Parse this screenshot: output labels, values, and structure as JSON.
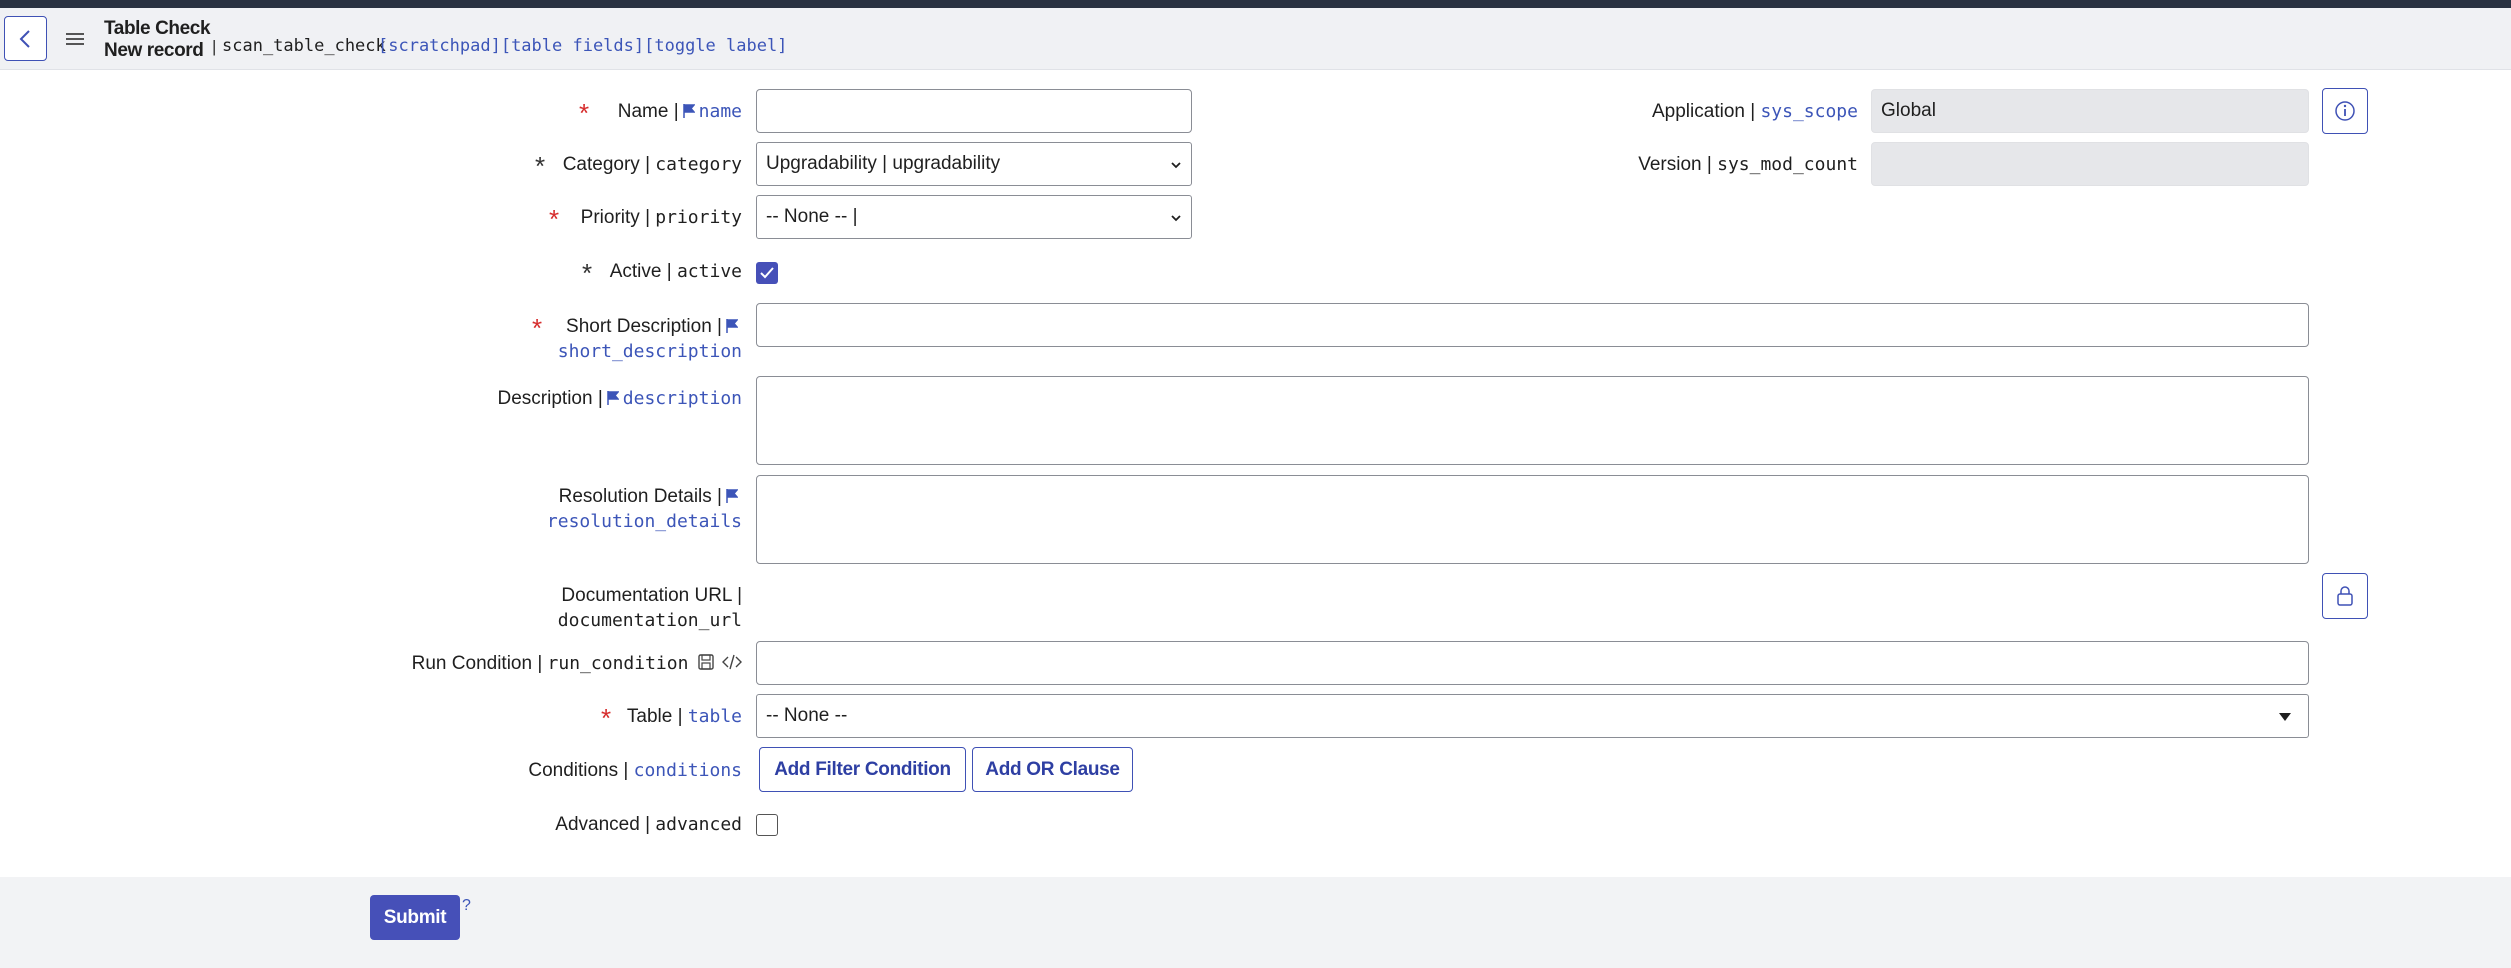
{
  "header": {
    "title_line1": "Table Check",
    "title_line2": "New record",
    "separator": "|",
    "table_name": "scan_table_check",
    "links": [
      "[scratchpad]",
      "[table fields]",
      "[toggle label]"
    ]
  },
  "fields": {
    "name": {
      "label": "Name |",
      "field": "name",
      "value": ""
    },
    "category": {
      "label": "Category |",
      "field": "category",
      "value": "Upgradability | upgradability"
    },
    "priority": {
      "label": "Priority |",
      "field": "priority",
      "value": "-- None -- |"
    },
    "active": {
      "label": "Active |",
      "field": "active",
      "checked": true
    },
    "short_description": {
      "label": "Short Description |",
      "field": "short_description",
      "value": ""
    },
    "description": {
      "label": "Description |",
      "field": "description",
      "value": ""
    },
    "resolution_details": {
      "label": "Resolution Details |",
      "field": "resolution_details",
      "value": ""
    },
    "documentation_url": {
      "label": "Documentation URL |",
      "field": "documentation_url"
    },
    "run_condition": {
      "label": "Run Condition |",
      "field": "run_condition",
      "value": ""
    },
    "table": {
      "label": "Table |",
      "field": "table",
      "value": "-- None --"
    },
    "conditions": {
      "label": "Conditions |",
      "field": "conditions",
      "add_filter_label": "Add Filter Condition",
      "add_or_label": "Add OR Clause"
    },
    "advanced": {
      "label": "Advanced |",
      "field": "advanced",
      "checked": false
    },
    "application": {
      "label": "Application |",
      "field": "sys_scope",
      "value": "Global"
    },
    "version": {
      "label": "Version |",
      "field": "sys_mod_count",
      "value": ""
    }
  },
  "footer": {
    "submit_label": "Submit",
    "help_label": "?"
  },
  "colors": {
    "accent": "#4650b8",
    "required": "#d62d2d",
    "link": "#3c55b8"
  },
  "icons": [
    "back-arrow-icon",
    "hamburger-menu-icon",
    "flag-icon",
    "info-icon",
    "lock-icon",
    "save-icon",
    "code-icon",
    "chevron-down-icon",
    "checkmark-icon"
  ]
}
